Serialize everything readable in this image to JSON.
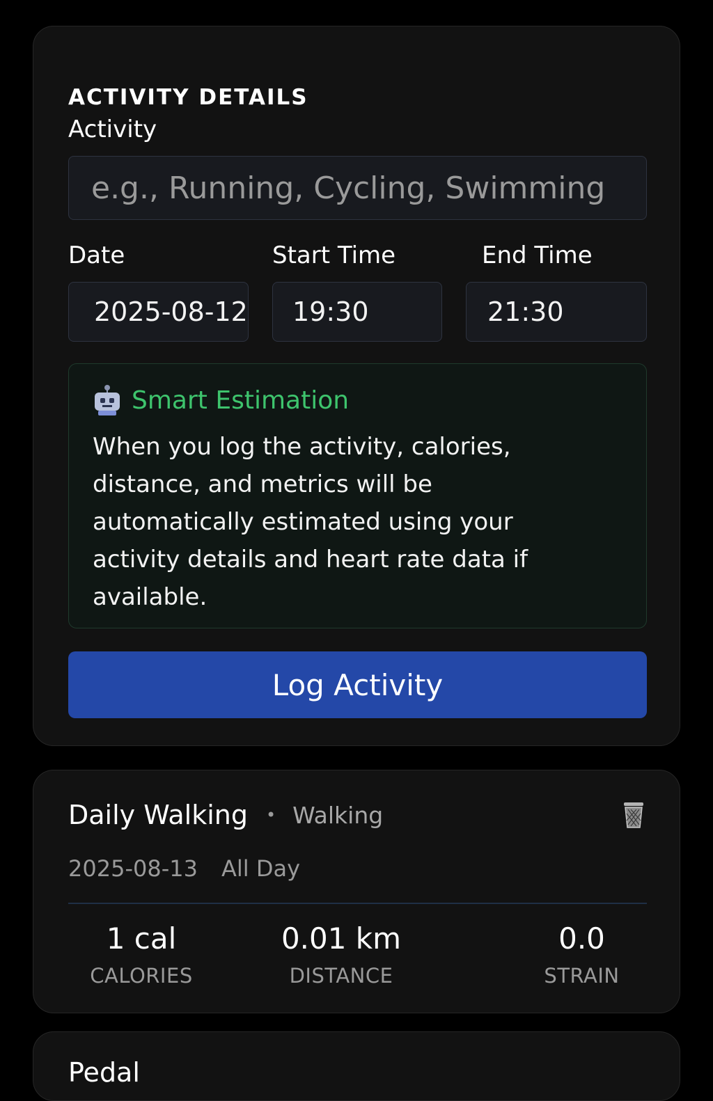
{
  "details": {
    "section_title": "ACTIVITY DETAILS",
    "activity_label": "Activity",
    "activity_placeholder": "e.g., Running, Cycling, Swimming",
    "date_label": "Date",
    "date_value": "2025-08-12",
    "start_label": "Start Time",
    "start_value": "19:30",
    "end_label": "End Time",
    "end_value": "21:30",
    "estimation": {
      "icon": "robot-icon",
      "title": "Smart Estimation",
      "text": "When you log the activity, calories, distance, and metrics will be automatically estimated using your activity details and heart rate data if available."
    },
    "log_button": "Log Activity"
  },
  "activities": [
    {
      "name": "Daily Walking",
      "separator": "•",
      "type": "Walking",
      "date": "2025-08-13",
      "time": "All Day",
      "calories_value": "1 cal",
      "calories_label": "CALORIES",
      "distance_value": "0.01 km",
      "distance_label": "DISTANCE",
      "strain_value": "0.0",
      "strain_label": "STRAIN"
    }
  ],
  "partial_item": {
    "name": "Pedal"
  },
  "colors": {
    "background": "#000000",
    "card": "#121212",
    "accent_green": "#3ec46d",
    "button_blue": "#2448a8"
  }
}
